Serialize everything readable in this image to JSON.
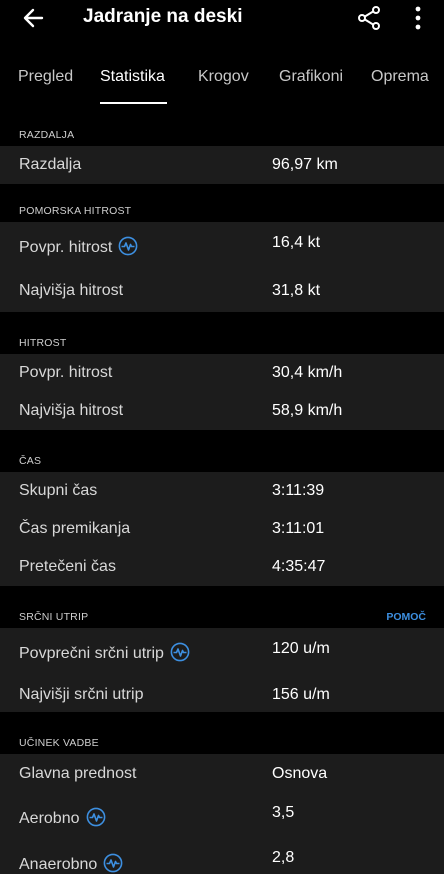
{
  "header": {
    "title": "Jadranje na deski"
  },
  "tabs": [
    {
      "label": "Pregled"
    },
    {
      "label": "Statistika"
    },
    {
      "label": "Krogov"
    },
    {
      "label": "Grafikoni"
    },
    {
      "label": "Oprema"
    }
  ],
  "sections": {
    "distance": {
      "title": "RAZDALJA",
      "rows": [
        {
          "name": "Razdalja",
          "value": "96,97 km"
        }
      ]
    },
    "nautical": {
      "title": "POMORSKA HITROST",
      "rows": [
        {
          "name": "Povpr. hitrost",
          "value": "16,4 kt"
        },
        {
          "name": "Najvišja hitrost",
          "value": "31,8 kt"
        }
      ]
    },
    "speed": {
      "title": "HITROST",
      "rows": [
        {
          "name": "Povpr. hitrost",
          "value": "30,4 km/h"
        },
        {
          "name": "Najvišja hitrost",
          "value": "58,9 km/h"
        }
      ]
    },
    "time": {
      "title": "ČAS",
      "rows": [
        {
          "name": "Skupni čas",
          "value": "3:11:39"
        },
        {
          "name": "Čas premikanja",
          "value": "3:11:01"
        },
        {
          "name": "Pretečeni čas",
          "value": "4:35:47"
        }
      ]
    },
    "heart": {
      "title": "SRČNI UTRIP",
      "help": "POMOČ",
      "rows": [
        {
          "name": "Povprečni srčni utrip",
          "value": "120 u/m"
        },
        {
          "name": "Najvišji srčni utrip",
          "value": "156 u/m"
        }
      ]
    },
    "effect": {
      "title": "UČINEK VADBE",
      "rows": [
        {
          "name": "Glavna prednost",
          "value": "Osnova"
        },
        {
          "name": "Aerobno",
          "value": "3,5"
        },
        {
          "name": "Anaerobno",
          "value": "2,8"
        }
      ]
    }
  },
  "colors": {
    "accent": "#3d8fe0",
    "background": "#1c1c1c",
    "header_bg": "#000000"
  },
  "icons": [
    "back-arrow-icon",
    "share-icon",
    "more-vertical-icon",
    "heart-pulse-icon"
  ]
}
